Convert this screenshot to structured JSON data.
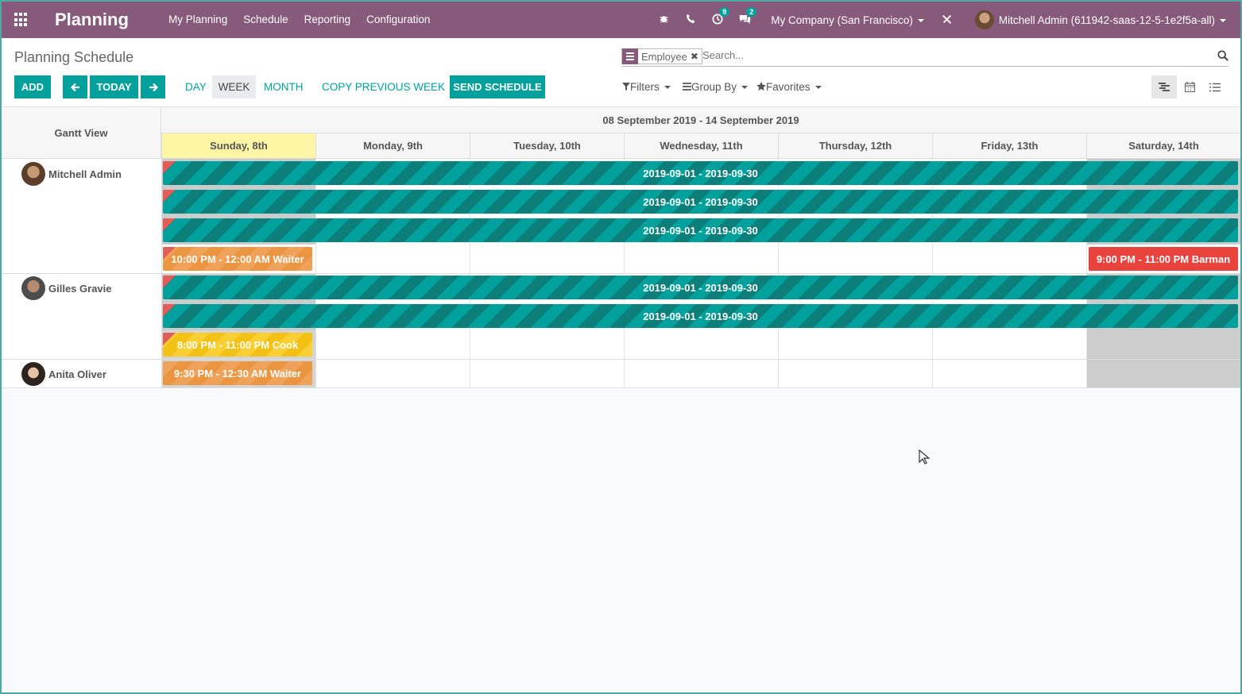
{
  "navbar": {
    "brand": "Planning",
    "menu": [
      "My Planning",
      "Schedule",
      "Reporting",
      "Configuration"
    ],
    "activity_count": "9",
    "messages_count": "2",
    "company": "My Company (San Francisco)",
    "user": "Mitchell Admin (611942-saas-12-5-1e2f5a-all)"
  },
  "control_panel": {
    "title": "Planning Schedule",
    "facet_label": "Employee",
    "search_placeholder": "Search...",
    "add_label": "ADD",
    "today_label": "TODAY",
    "scales": [
      "DAY",
      "WEEK",
      "MONTH"
    ],
    "active_scale": "WEEK",
    "copy_label": "COPY PREVIOUS WEEK",
    "send_label": "SEND SCHEDULE",
    "filters_label": "Filters",
    "groupby_label": "Group By",
    "favorites_label": "Favorites"
  },
  "gantt": {
    "title": "Gantt View",
    "range": "08 September 2019 - 14 September 2019",
    "days": [
      "Sunday, 8th",
      "Monday, 9th",
      "Tuesday, 10th",
      "Wednesday, 11th",
      "Thursday, 12th",
      "Friday, 13th",
      "Saturday, 14th"
    ],
    "rows": [
      {
        "name": "Mitchell Admin"
      },
      {
        "name": "Gilles Gravie"
      },
      {
        "name": "Anita Oliver"
      }
    ],
    "pills": {
      "range_label": "2019-09-01 - 2019-09-30",
      "mitchell_sun": "10:00 PM - 12:00 AM Waiter",
      "mitchell_sat": "9:00 PM - 11:00 PM Barman",
      "gilles_sun": "8:00 PM - 11:00 PM Cook",
      "anita_sun": "9:30 PM - 12:30 AM Waiter"
    }
  },
  "colors": {
    "navbar": "#875a7b",
    "accent": "#00a09d",
    "today": "#fcf6a5",
    "waiter": "#f0a15a",
    "cook": "#f9cf33",
    "barman": "#e8433d"
  }
}
